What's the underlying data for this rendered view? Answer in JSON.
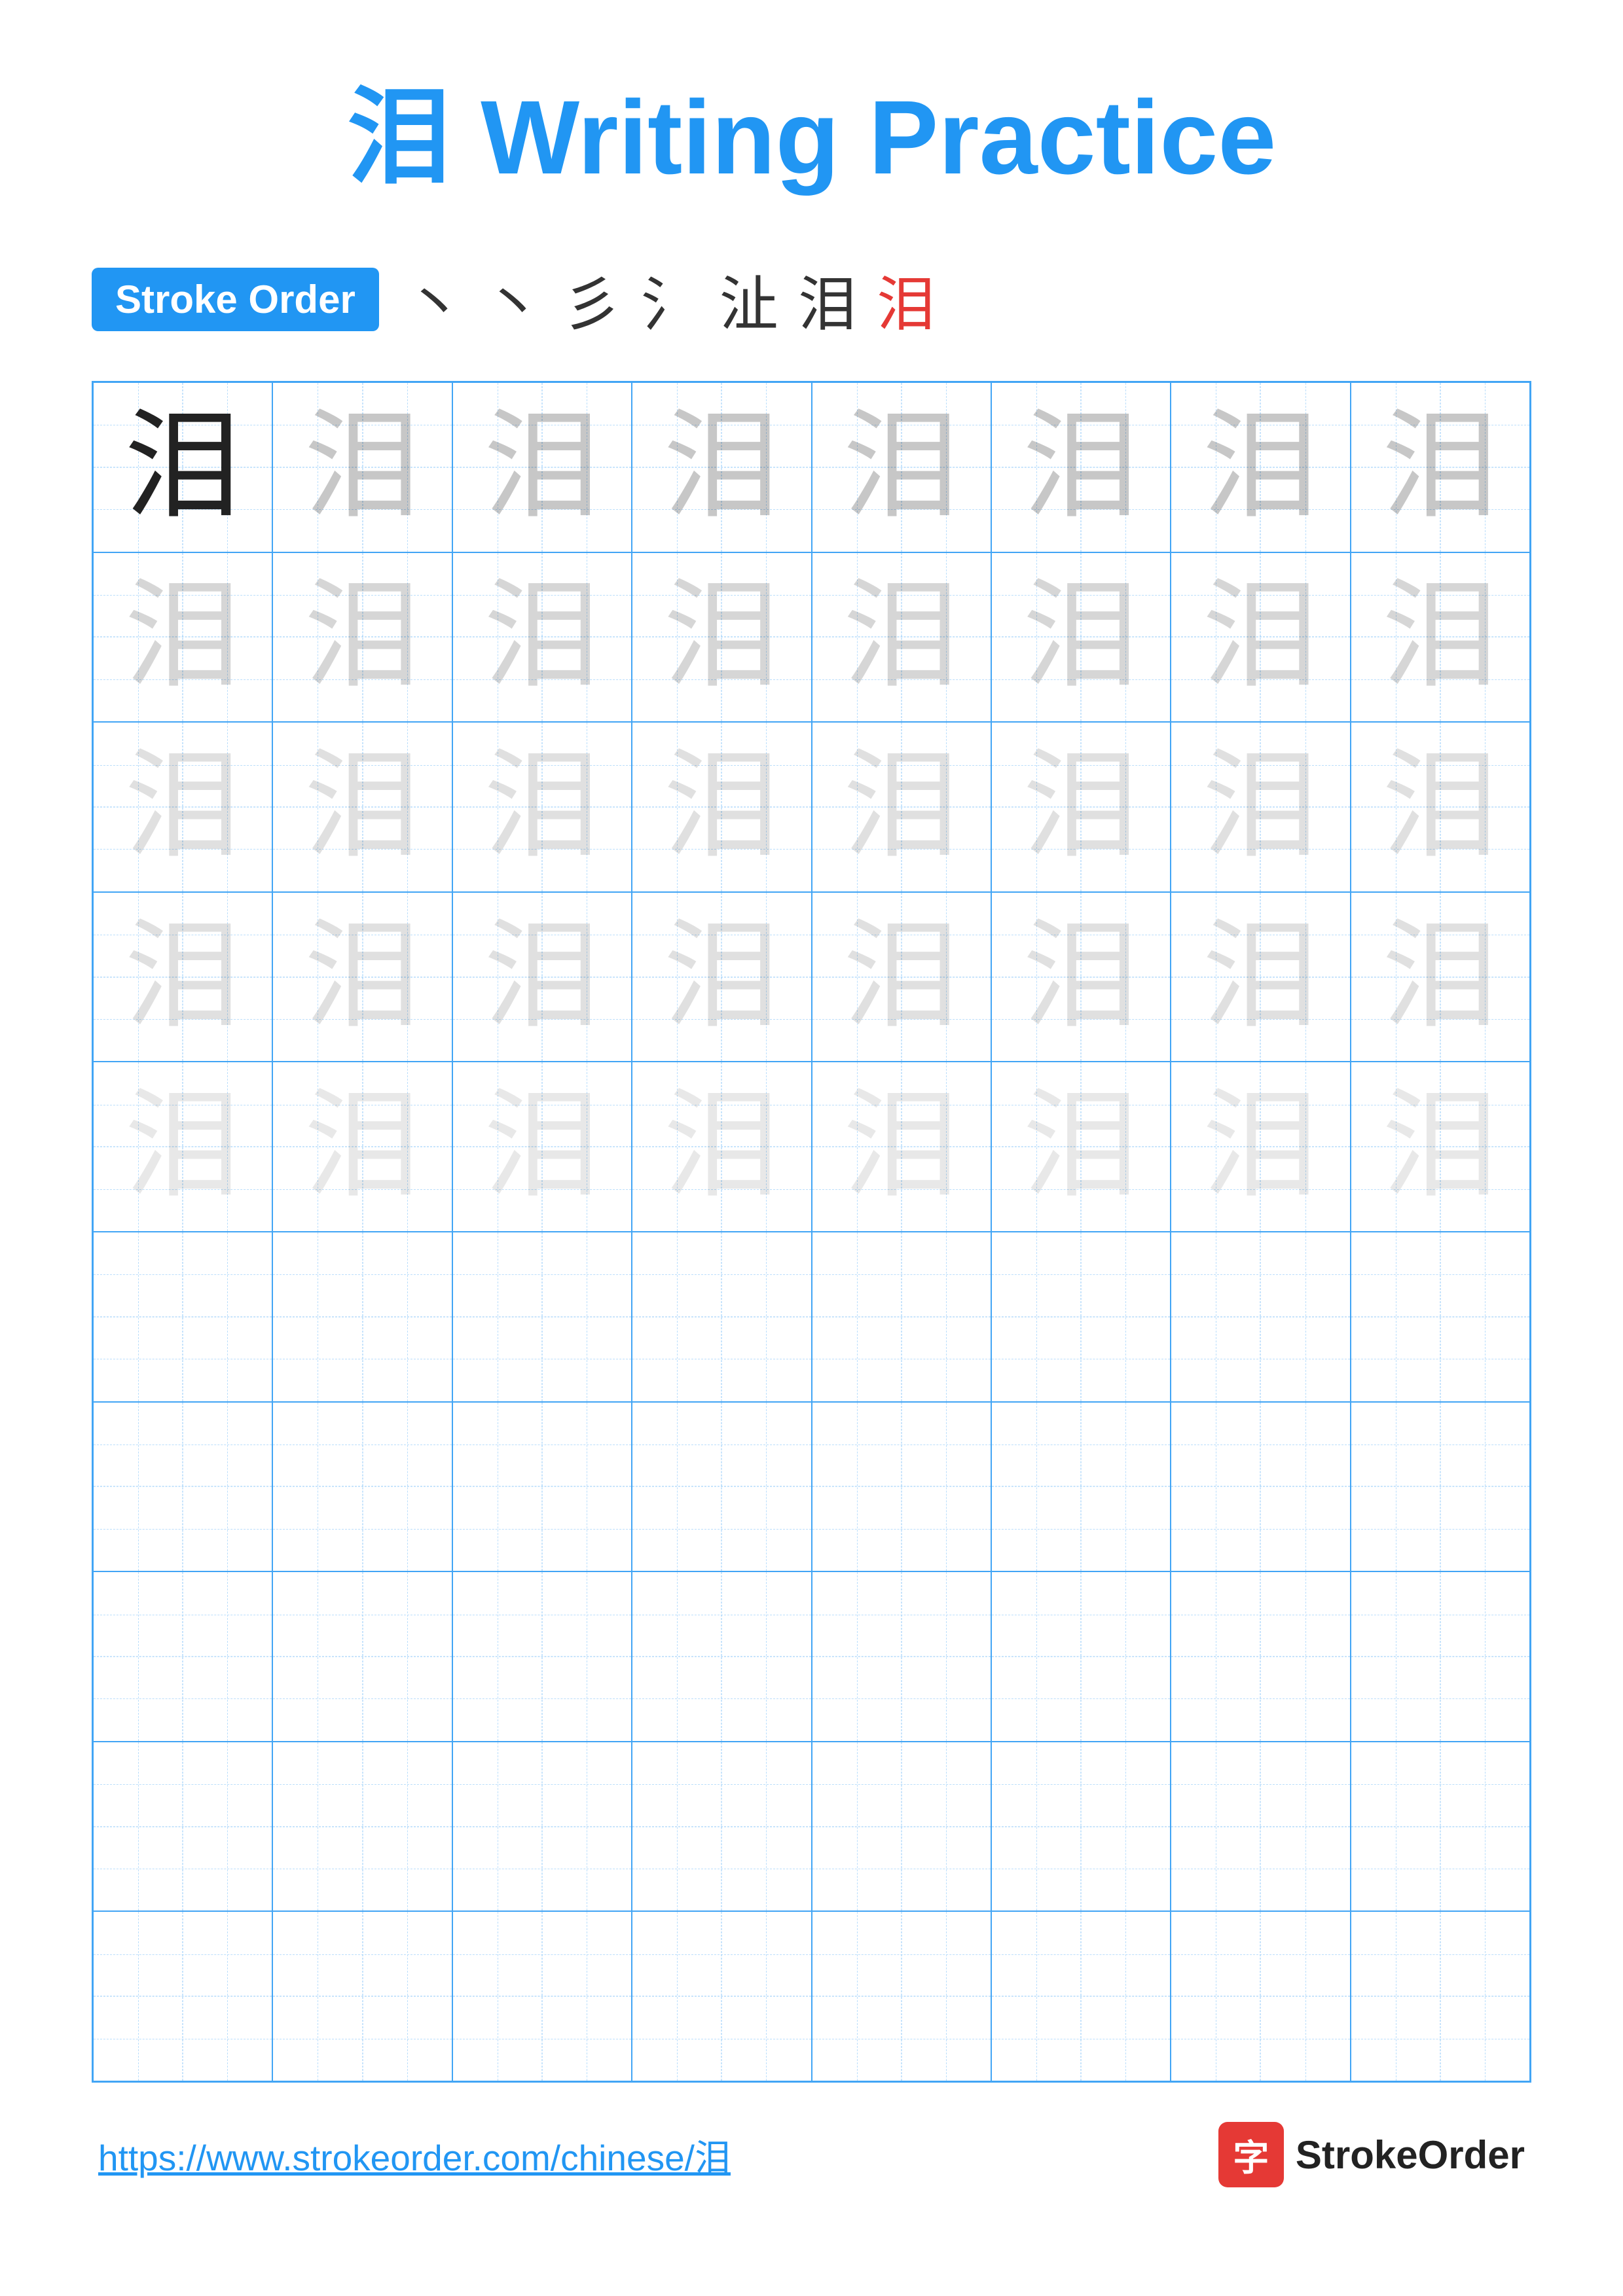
{
  "title": {
    "char": "泪",
    "text": "Writing Practice",
    "color": "#2196F3"
  },
  "stroke_order": {
    "badge_label": "Stroke Order",
    "strokes": [
      "丶",
      "丶",
      "彡",
      "氵",
      "沚",
      "泪",
      "泪"
    ]
  },
  "grid": {
    "rows": 10,
    "cols": 8,
    "char": "泪",
    "filled_rows": 5
  },
  "footer": {
    "url": "https://www.strokeorder.com/chinese/泪",
    "logo_char": "字",
    "logo_name": "StrokeOrder"
  }
}
